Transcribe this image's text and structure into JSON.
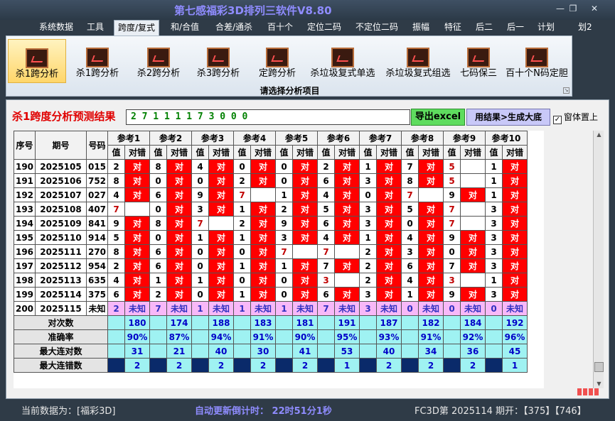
{
  "window": {
    "title": "第七感福彩3D排列三软件V8.80",
    "minimize": "—",
    "restore": "❐",
    "close": "✕"
  },
  "menu": {
    "items": [
      "系统数据",
      "工具",
      "跨度/复式",
      "和/合值",
      "合差/通杀",
      "百十个",
      "定位二码",
      "不定位二码",
      "振幅",
      "特征",
      "后二",
      "后一",
      "计划",
      "划2"
    ],
    "active": "跨度/复式"
  },
  "ribbon": {
    "buttons": [
      "杀1跨分析",
      "杀1跨分析",
      "杀2跨分析",
      "杀3跨分析",
      "定跨分析",
      "杀垃圾复式单选",
      "杀垃圾复式组选",
      "七码保三",
      "百十个N码定胆"
    ],
    "active_index": 0,
    "caption": "请选择分析项目",
    "icon": "chart-icon"
  },
  "panel": {
    "title": "杀1跨度分析预测结果",
    "result": "2 7 1 1 1 1 7 3 0 0 0",
    "export_label": "导出excel",
    "generate_label": "用结果>生成大底",
    "topmost_label": "窗体置上",
    "topmost_checked": "✓"
  },
  "table": {
    "headers": {
      "seq": "序号",
      "issue": "期号",
      "code": "号码",
      "refs": [
        "参考1",
        "参考2",
        "参考3",
        "参考4",
        "参考5",
        "参考6",
        "参考7",
        "参考8",
        "参考9",
        "参考10"
      ],
      "val": "值",
      "chk": "对错"
    },
    "rows": [
      {
        "seq": "190",
        "issue": "2025105",
        "code": "015",
        "cells": [
          [
            "2",
            "对"
          ],
          [
            "8",
            "对"
          ],
          [
            "4",
            "对"
          ],
          [
            "0",
            "对"
          ],
          [
            "0",
            "对"
          ],
          [
            "2",
            "对"
          ],
          [
            "1",
            "对"
          ],
          [
            "7",
            "对"
          ],
          [
            "5",
            ""
          ],
          [
            "1",
            "对"
          ]
        ]
      },
      {
        "seq": "191",
        "issue": "2025106",
        "code": "752",
        "cells": [
          [
            "8",
            "对"
          ],
          [
            "0",
            "对"
          ],
          [
            "0",
            "对"
          ],
          [
            "2",
            "对"
          ],
          [
            "0",
            "对"
          ],
          [
            "6",
            "对"
          ],
          [
            "3",
            "对"
          ],
          [
            "8",
            "对"
          ],
          [
            "5",
            ""
          ],
          [
            "1",
            "对"
          ]
        ]
      },
      {
        "seq": "192",
        "issue": "2025107",
        "code": "027",
        "cells": [
          [
            "4",
            "对"
          ],
          [
            "6",
            "对"
          ],
          [
            "9",
            "对"
          ],
          [
            "7",
            ""
          ],
          [
            "1",
            "对"
          ],
          [
            "4",
            "对"
          ],
          [
            "0",
            "对"
          ],
          [
            "7",
            ""
          ],
          [
            "9",
            "对"
          ],
          [
            "1",
            "对"
          ]
        ]
      },
      {
        "seq": "193",
        "issue": "2025108",
        "code": "407",
        "cells": [
          [
            "7",
            ""
          ],
          [
            "0",
            "对"
          ],
          [
            "3",
            "对"
          ],
          [
            "1",
            "对"
          ],
          [
            "2",
            "对"
          ],
          [
            "5",
            "对"
          ],
          [
            "3",
            "对"
          ],
          [
            "5",
            "对"
          ],
          [
            "7",
            ""
          ],
          [
            "3",
            "对"
          ]
        ]
      },
      {
        "seq": "194",
        "issue": "2025109",
        "code": "841",
        "cells": [
          [
            "9",
            "对"
          ],
          [
            "8",
            "对"
          ],
          [
            "7",
            ""
          ],
          [
            "2",
            "对"
          ],
          [
            "9",
            "对"
          ],
          [
            "6",
            "对"
          ],
          [
            "3",
            "对"
          ],
          [
            "0",
            "对"
          ],
          [
            "7",
            ""
          ],
          [
            "3",
            "对"
          ]
        ]
      },
      {
        "seq": "195",
        "issue": "2025110",
        "code": "914",
        "cells": [
          [
            "5",
            "对"
          ],
          [
            "0",
            "对"
          ],
          [
            "1",
            "对"
          ],
          [
            "1",
            "对"
          ],
          [
            "3",
            "对"
          ],
          [
            "4",
            "对"
          ],
          [
            "1",
            "对"
          ],
          [
            "4",
            "对"
          ],
          [
            "9",
            "对"
          ],
          [
            "3",
            "对"
          ]
        ]
      },
      {
        "seq": "196",
        "issue": "2025111",
        "code": "270",
        "cells": [
          [
            "8",
            "对"
          ],
          [
            "6",
            "对"
          ],
          [
            "0",
            "对"
          ],
          [
            "0",
            "对"
          ],
          [
            "7",
            ""
          ],
          [
            "7",
            ""
          ],
          [
            "2",
            "对"
          ],
          [
            "3",
            "对"
          ],
          [
            "0",
            "对"
          ],
          [
            "3",
            "对"
          ]
        ]
      },
      {
        "seq": "197",
        "issue": "2025112",
        "code": "954",
        "cells": [
          [
            "2",
            "对"
          ],
          [
            "6",
            "对"
          ],
          [
            "0",
            "对"
          ],
          [
            "1",
            "对"
          ],
          [
            "1",
            "对"
          ],
          [
            "7",
            "对"
          ],
          [
            "2",
            "对"
          ],
          [
            "6",
            "对"
          ],
          [
            "7",
            "对"
          ],
          [
            "3",
            "对"
          ]
        ]
      },
      {
        "seq": "198",
        "issue": "2025113",
        "code": "635",
        "cells": [
          [
            "4",
            "对"
          ],
          [
            "1",
            "对"
          ],
          [
            "1",
            "对"
          ],
          [
            "0",
            "对"
          ],
          [
            "0",
            "对"
          ],
          [
            "3",
            ""
          ],
          [
            "2",
            "对"
          ],
          [
            "4",
            "对"
          ],
          [
            "3",
            ""
          ],
          [
            "1",
            "对"
          ]
        ]
      },
      {
        "seq": "199",
        "issue": "2025114",
        "code": "375",
        "cells": [
          [
            "6",
            "对"
          ],
          [
            "2",
            "对"
          ],
          [
            "0",
            "对"
          ],
          [
            "1",
            "对"
          ],
          [
            "0",
            "对"
          ],
          [
            "6",
            "对"
          ],
          [
            "3",
            "对"
          ],
          [
            "1",
            "对"
          ],
          [
            "9",
            "对"
          ],
          [
            "3",
            "对"
          ]
        ]
      },
      {
        "seq": "200",
        "issue": "2025115",
        "code": "未知",
        "cells": [
          [
            "2",
            "未知"
          ],
          [
            "7",
            "未知"
          ],
          [
            "1",
            "未知"
          ],
          [
            "1",
            "未知"
          ],
          [
            "1",
            "未知"
          ],
          [
            "7",
            "未知"
          ],
          [
            "3",
            "未知"
          ],
          [
            "0",
            "未知"
          ],
          [
            "0",
            "未知"
          ],
          [
            "0",
            "未知"
          ]
        ]
      }
    ],
    "stats": [
      {
        "label": "对次数",
        "values": [
          "180",
          "174",
          "188",
          "183",
          "181",
          "191",
          "187",
          "182",
          "184",
          "192"
        ]
      },
      {
        "label": "准确率",
        "values": [
          "90%",
          "87%",
          "94%",
          "91%",
          "90%",
          "95%",
          "93%",
          "91%",
          "92%",
          "96%"
        ]
      },
      {
        "label": "最大连对数",
        "values": [
          "31",
          "21",
          "40",
          "30",
          "41",
          "53",
          "40",
          "34",
          "36",
          "45"
        ]
      },
      {
        "label": "最大连错数",
        "values": [
          "2",
          "2",
          "2",
          "2",
          "2",
          "1",
          "2",
          "2",
          "2",
          "1"
        ]
      }
    ]
  },
  "status": {
    "current_data": "当前数据为：[福彩3D]",
    "countdown": "自动更新倒计时： 22时51分1秒",
    "last": "FC3D第 2025114 期开：【375】【746】"
  }
}
